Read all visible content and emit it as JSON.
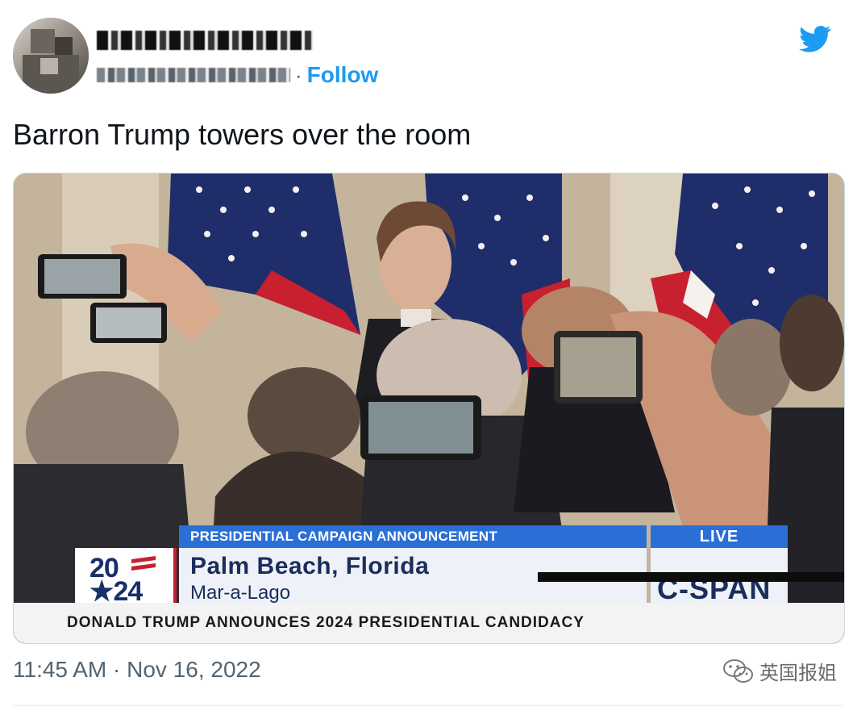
{
  "tweet": {
    "follow_label": "Follow",
    "separator": "·",
    "text": "Barron Trump towers over the room",
    "timestamp": "11:45 AM · Nov 16, 2022",
    "brand_color": "#1d9bf0"
  },
  "broadcast": {
    "banner_label": "PRESIDENTIAL CAMPAIGN ANNOUNCEMENT",
    "live_label": "LIVE",
    "logo_top": "20",
    "logo_bottom": "★24",
    "location_main": "Palm Beach, Florida",
    "location_sub": "Mar-a-Lago",
    "network": "C-SPAN",
    "ticker": "DONALD TRUMP ANNOUNCES 2024 PRESIDENTIAL CANDIDACY",
    "accent_blue": "#2a6fd6",
    "accent_red": "#c81f2d"
  },
  "watermark": {
    "text": "英国报姐",
    "icon": "wechat-icon"
  }
}
